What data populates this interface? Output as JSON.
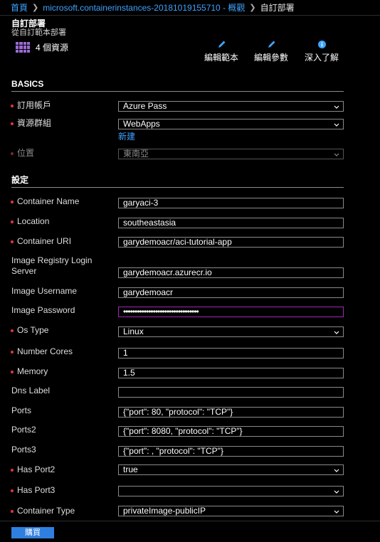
{
  "breadcrumb": {
    "home": "首頁",
    "resource_group": "microsoft.containerinstances-20181019155710 - 概觀",
    "current": "自訂部署"
  },
  "blade": {
    "title": "自訂部署",
    "subtitle": "從自訂範本部署"
  },
  "resources": {
    "label": "4 個資源",
    "icon": "resources-grid-icon"
  },
  "toolbar": {
    "edit_template": "編輯範本",
    "edit_parameters": "編輯參數",
    "learn_more": "深入了解"
  },
  "sections": {
    "basics": "BASICS",
    "settings": "設定"
  },
  "basics": {
    "subscription": {
      "label": "訂用帳戶",
      "value": "Azure Pass"
    },
    "resource_group": {
      "label": "資源群組",
      "value": "WebApps",
      "new_link": "新建"
    },
    "location": {
      "label": "位置",
      "value": "東南亞"
    }
  },
  "settings": {
    "container_name": {
      "label": "Container Name",
      "value": "garyaci-3"
    },
    "location": {
      "label": "Location",
      "value": "southeastasia"
    },
    "container_uri": {
      "label": "Container URI",
      "value": "garydemoacr/aci-tutorial-app"
    },
    "registry_server": {
      "label": "Image Registry Login Server",
      "value": "garydemoacr.azurecr.io"
    },
    "image_username": {
      "label": "Image Username",
      "value": "garydemoacr"
    },
    "image_password": {
      "label": "Image Password",
      "value": "•••••••••••••••••••••••••••••••••"
    },
    "os_type": {
      "label": "Os Type",
      "value": "Linux"
    },
    "number_cores": {
      "label": "Number Cores",
      "value": "1"
    },
    "memory": {
      "label": "Memory",
      "value": "1.5"
    },
    "dns_label": {
      "label": "Dns Label",
      "value": ""
    },
    "ports": {
      "label": "Ports",
      "value": "{\"port\":  80, \"protocol\": \"TCP\"}"
    },
    "ports2": {
      "label": "Ports2",
      "value": "{\"port\":  8080, \"protocol\": \"TCP\"}"
    },
    "ports3": {
      "label": "Ports3",
      "value": "{\"port\":  , \"protocol\": \"TCP\"}"
    },
    "has_port2": {
      "label": "Has Port2",
      "value": "true"
    },
    "has_port3": {
      "label": "Has Port3",
      "value": ""
    },
    "container_type": {
      "label": "Container Type",
      "value": "privateImage-publicIP"
    }
  },
  "footer": {
    "buy_label": "購買"
  },
  "colors": {
    "accent": "#3fa3ff",
    "required": "#e0373f",
    "focus_border": "#a128b5",
    "button": "#2f7fe0",
    "resource_icon": "#9b6bd3"
  }
}
